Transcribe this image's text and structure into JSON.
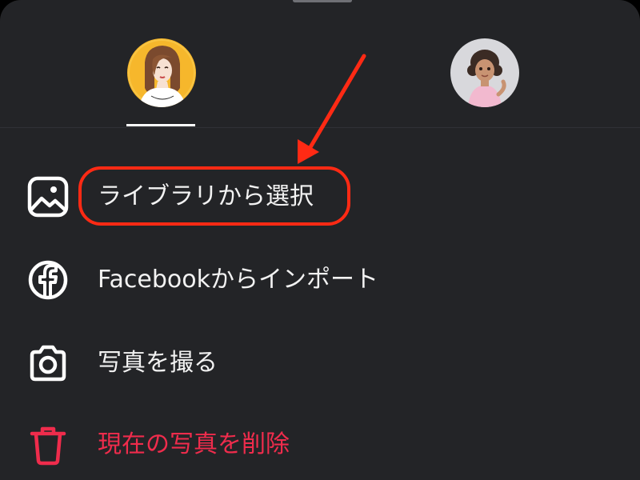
{
  "profile_tabs": {
    "left": {
      "avatar_icon": "illustrated-woman-avatar-icon",
      "selected": true
    },
    "right": {
      "avatar_icon": "3d-girl-avatar-icon",
      "selected": false
    }
  },
  "menu": {
    "items": [
      {
        "label": "ライブラリから選択",
        "icon": "photo-library-icon",
        "color": "#f2f2f2",
        "highlighted": true
      },
      {
        "label": "Facebookからインポート",
        "icon": "facebook-icon",
        "color": "#f2f2f2"
      },
      {
        "label": "写真を撮る",
        "icon": "camera-icon",
        "color": "#f2f2f2"
      },
      {
        "label": "現在の写真を削除",
        "icon": "trash-icon",
        "color": "#ef2c4c"
      }
    ]
  },
  "annotation": {
    "color": "#ff2a14",
    "target": "ライブラリから選択"
  },
  "colors": {
    "background": "#232427",
    "text": "#f2f2f2",
    "danger": "#ef2c4c",
    "annotation": "#ff2a14"
  }
}
